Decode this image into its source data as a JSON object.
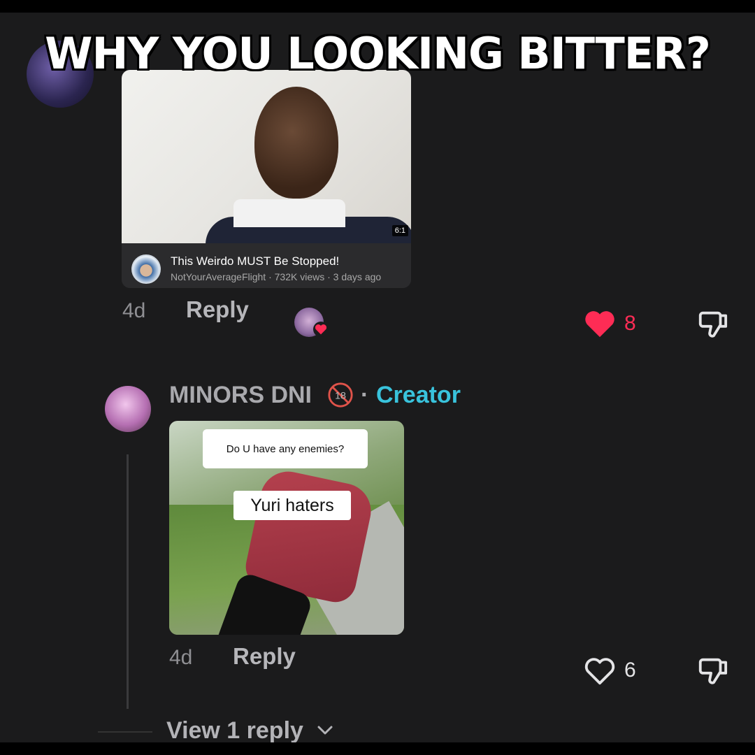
{
  "meme": {
    "caption": "WHY YOU LOOKING BITTER?"
  },
  "comment1": {
    "video": {
      "duration": "6:1",
      "title": "This Weirdo MUST Be Stopped!",
      "meta": "NotYourAverageFlight · 732K views · 3 days ago"
    },
    "age": "4d",
    "reply_label": "Reply",
    "likes": "8",
    "liked": true,
    "colors": {
      "like": "#fe2c55"
    }
  },
  "comment2": {
    "username": "MINORS DNI",
    "separator": "·",
    "creator_label": "Creator",
    "age_badge": "18",
    "gif": {
      "question": "Do U have any enemies?",
      "answer": "Yuri haters"
    },
    "age": "4d",
    "reply_label": "Reply",
    "likes": "6",
    "liked": false,
    "colors": {
      "creator": "#39c3dc"
    }
  },
  "view_replies": "View 1 reply",
  "icons": [
    "heart-icon",
    "heart-outline-icon",
    "dislike-icon",
    "chevron-down-icon",
    "age-18-badge-icon"
  ]
}
